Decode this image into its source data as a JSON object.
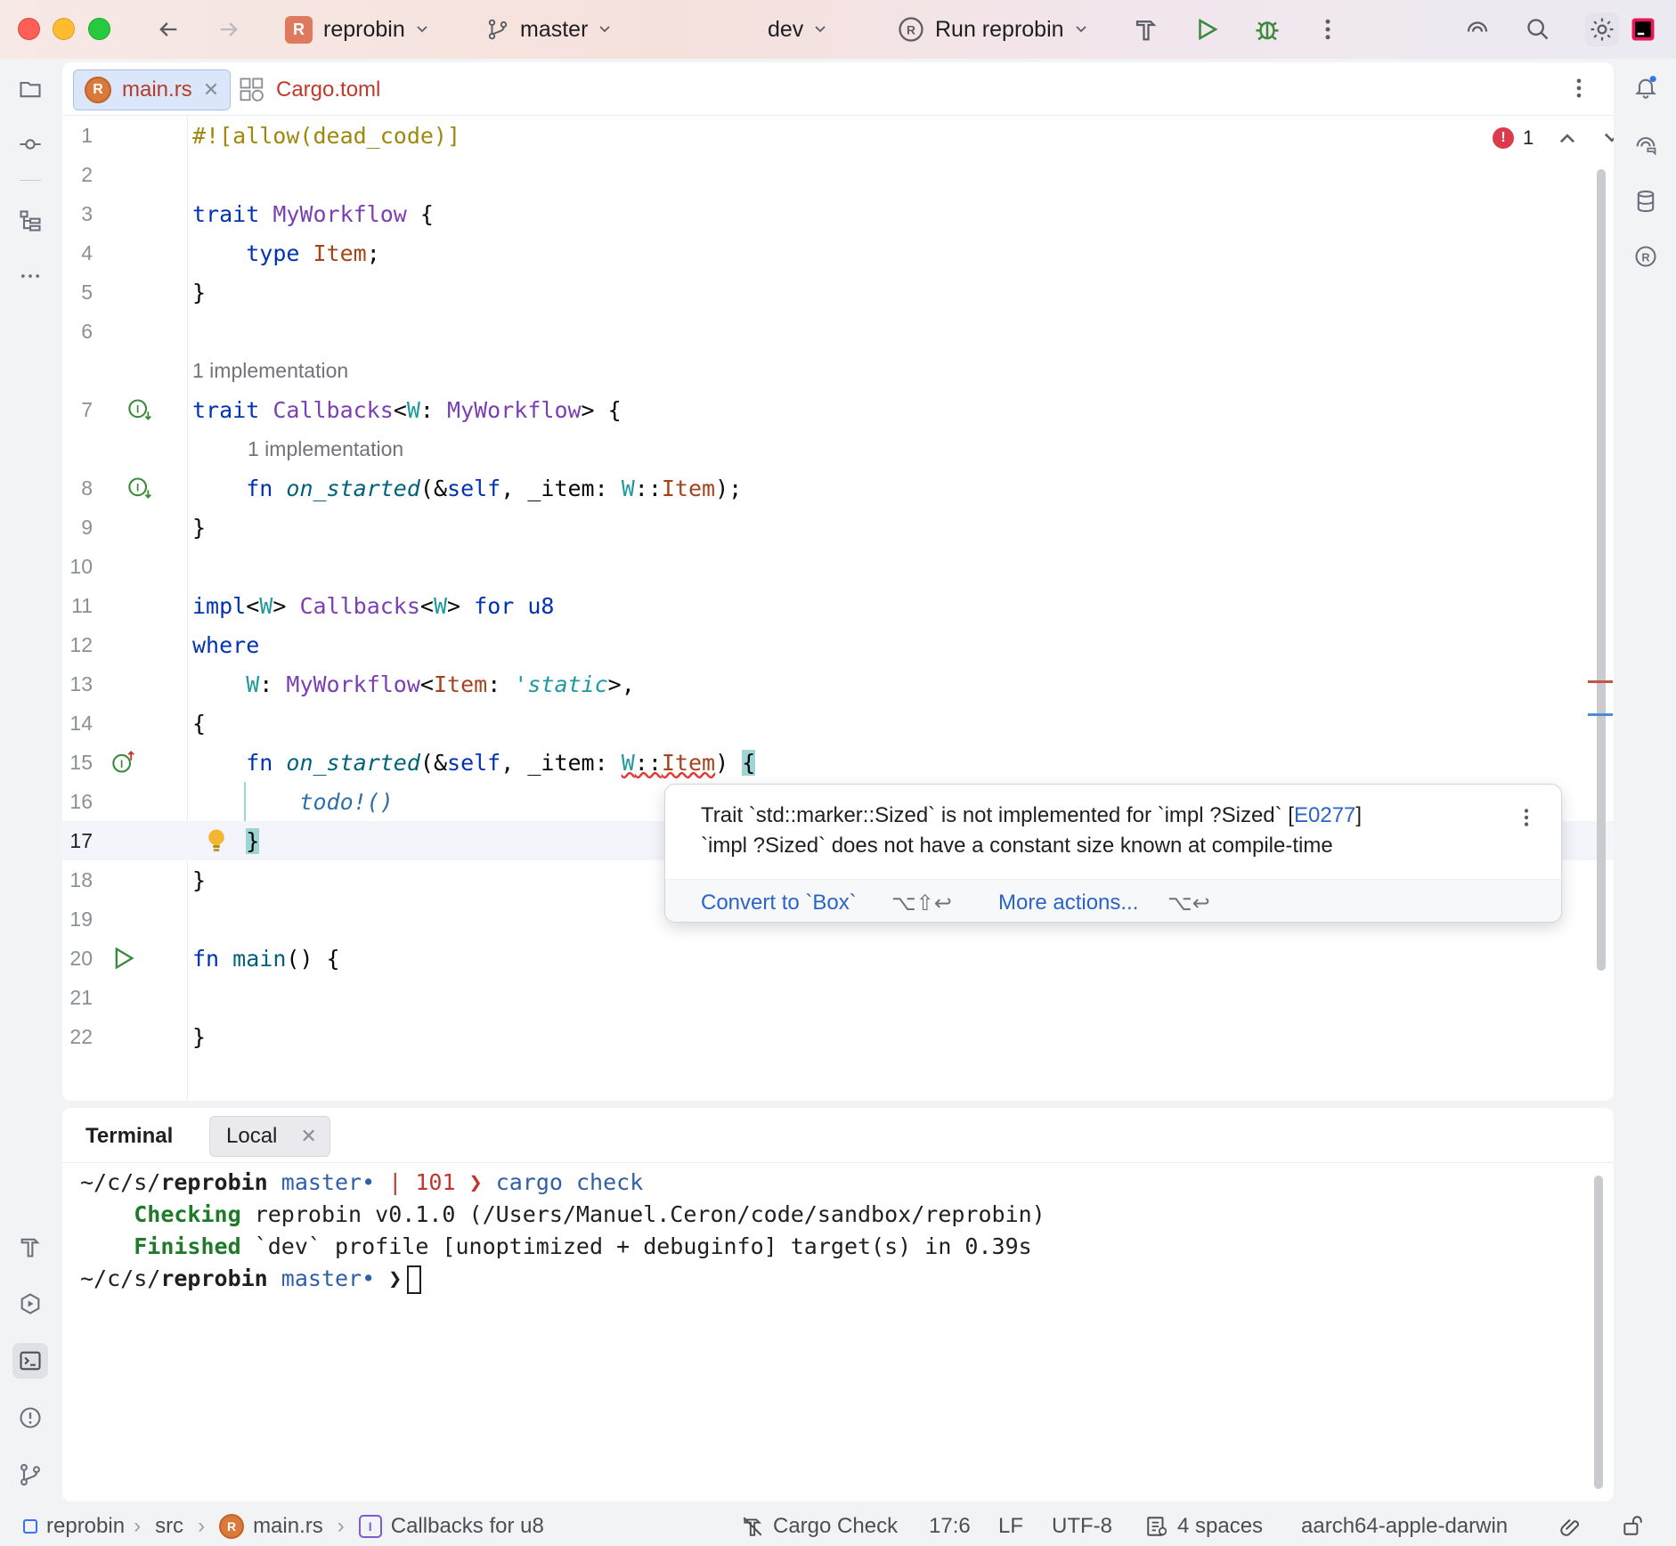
{
  "titlebar": {
    "project": "reprobin",
    "project_badge": "R",
    "branch": "master",
    "profile": "dev",
    "run_config": "Run reprobin"
  },
  "tabs": [
    {
      "label": "main.rs",
      "active": true
    },
    {
      "label": "Cargo.toml",
      "active": false
    }
  ],
  "editor": {
    "error_count": "1",
    "hints": {
      "h1": "1 implementation",
      "h2": "1 implementation"
    },
    "line_numbers": [
      "1",
      "2",
      "3",
      "4",
      "5",
      "6",
      "7",
      "8",
      "9",
      "10",
      "11",
      "12",
      "13",
      "14",
      "15",
      "16",
      "17",
      "18",
      "19",
      "20",
      "21",
      "22"
    ],
    "current_line": "17"
  },
  "popup": {
    "line1_prefix": "Trait `std::marker::Sized` is not implemented for `impl ?Sized` [",
    "line1_link": "E0277",
    "line1_suffix": "]",
    "line2": "`impl ?Sized` does not have a constant size known at compile-time",
    "action1": "Convert to `Box`",
    "action1_key": "⌥⇧↩",
    "action2": "More actions...",
    "action2_key": "⌥↩"
  },
  "terminal": {
    "title": "Terminal",
    "tab": "Local",
    "prompt_path_prefix": "~/c/s/",
    "prompt_dir": "reprobin",
    "prompt_branch": "master•",
    "prompt_sep": "|",
    "exit_code": "101",
    "prompt_arrow": "❯",
    "command": "cargo check",
    "out1_label": "Checking",
    "out1_text": "reprobin v0.1.0 (/Users/Manuel.Ceron/code/sandbox/reprobin)",
    "out2_label": "Finished",
    "out2_text": "`dev` profile [unoptimized + debuginfo] target(s) in 0.39s"
  },
  "statusbar": {
    "crumb1": "reprobin",
    "crumb2": "src",
    "crumb3": "main.rs",
    "crumb4": "Callbacks for u8",
    "cargo_check": "Cargo Check",
    "position": "17:6",
    "line_sep": "LF",
    "encoding": "UTF-8",
    "indent": "4 spaces",
    "target": "aarch64-apple-darwin"
  }
}
